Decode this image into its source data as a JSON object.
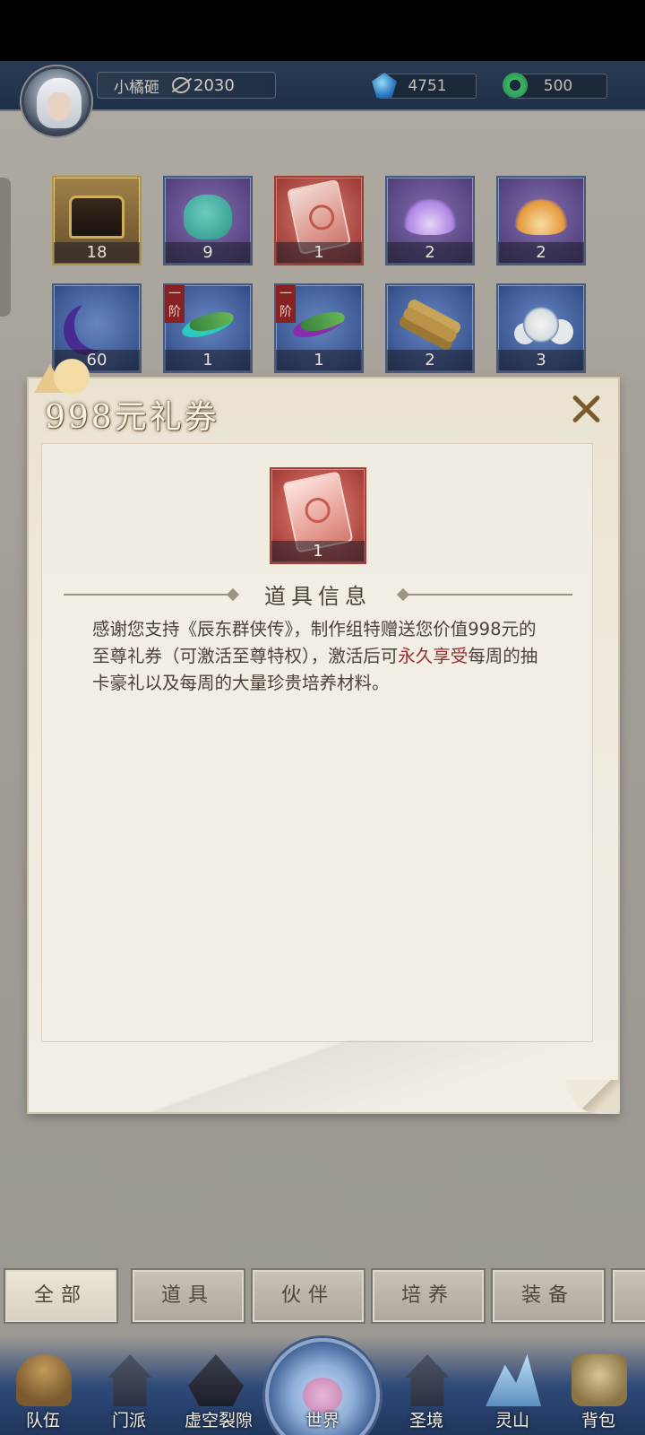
{
  "player": {
    "name": "小橘砸",
    "power": "2030"
  },
  "currencies": [
    {
      "icon": "gem-icon",
      "value": "4751"
    },
    {
      "icon": "jade-coin-icon",
      "value": "500"
    }
  ],
  "inventory": [
    {
      "name": "treasure-chest",
      "count": "18",
      "tier": ""
    },
    {
      "name": "cloth-bag",
      "count": "9",
      "tier": ""
    },
    {
      "name": "gift-voucher",
      "count": "1",
      "tier": ""
    },
    {
      "name": "purple-lotus",
      "count": "2",
      "tier": ""
    },
    {
      "name": "golden-lotus",
      "count": "2",
      "tier": ""
    },
    {
      "name": "crescent-moon",
      "count": "60",
      "tier": ""
    },
    {
      "name": "leaf-pill-cyan",
      "count": "1",
      "tier": "一阶"
    },
    {
      "name": "leaf-pill-purple",
      "count": "1",
      "tier": "一阶"
    },
    {
      "name": "herb-root-bundle",
      "count": "2",
      "tier": ""
    },
    {
      "name": "white-flower",
      "count": "3",
      "tier": ""
    }
  ],
  "modal": {
    "title": "998元礼券",
    "item_count": "1",
    "section_title": "道具信息",
    "desc_part1": "感谢您支持《辰东群侠传》，制作组特赠送您价值998元的至尊礼券（可激活至尊特权），激活后可",
    "desc_highlight": "永久享受",
    "desc_part2": "每周的抽卡豪礼以及每周的大量珍贵培养材料。"
  },
  "tabs": [
    {
      "label": "全部",
      "active": true
    },
    {
      "label": "道具",
      "active": false
    },
    {
      "label": "伙伴",
      "active": false
    },
    {
      "label": "培养",
      "active": false
    },
    {
      "label": "装备",
      "active": false
    }
  ],
  "nav": [
    {
      "label": "队伍"
    },
    {
      "label": "门派"
    },
    {
      "label": "虚空裂隙"
    },
    {
      "label": "世界"
    },
    {
      "label": "圣境"
    },
    {
      "label": "灵山"
    },
    {
      "label": "背包"
    }
  ],
  "colors": {
    "topbar": "#233249",
    "highlight_text": "#9a2c2c",
    "modal_bg": "#efe9dc"
  }
}
